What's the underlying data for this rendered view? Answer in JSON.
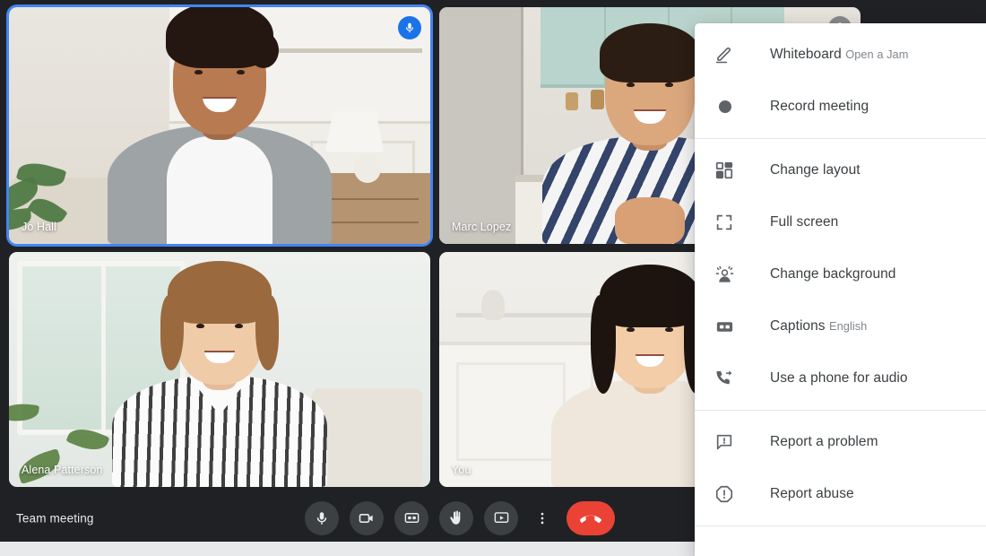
{
  "app": {
    "name": "video-meeting",
    "accent_blue": "#1a73e8",
    "active_border": "#4285f4",
    "hangup_red": "#ea4335",
    "bar_background": "#202124"
  },
  "grid": {
    "tiles": [
      {
        "name": "Jo Hall",
        "mic": "mic-on",
        "active": true,
        "position": "top-left"
      },
      {
        "name": "Marc Lopez",
        "mic": "mic-off",
        "active": false,
        "position": "top-right"
      },
      {
        "name": "Alena Patterson",
        "mic": "none",
        "active": false,
        "position": "bottom-left"
      },
      {
        "name": "You",
        "mic": "none",
        "active": false,
        "position": "bottom-right"
      }
    ]
  },
  "bottom_bar": {
    "meeting_title": "Team meeting",
    "controls": [
      {
        "icon": "microphone-icon",
        "label": "Turn off microphone"
      },
      {
        "icon": "camera-icon",
        "label": "Turn off camera"
      },
      {
        "icon": "captions-cc-icon",
        "label": "Turn on captions"
      },
      {
        "icon": "raise-hand-icon",
        "label": "Raise hand"
      },
      {
        "icon": "present-screen-icon",
        "label": "Present now"
      },
      {
        "icon": "more-options-icon",
        "label": "More options"
      },
      {
        "icon": "end-call-icon",
        "label": "Leave call"
      }
    ]
  },
  "options_menu": {
    "groups": [
      {
        "items": [
          {
            "icon": "whiteboard-pen-icon",
            "label": "Whiteboard",
            "sub": "Open a Jam"
          },
          {
            "icon": "record-dot-icon",
            "label": "Record meeting",
            "sub": ""
          }
        ]
      },
      {
        "items": [
          {
            "icon": "layout-grid-icon",
            "label": "Change layout",
            "sub": ""
          },
          {
            "icon": "fullscreen-icon",
            "label": "Full screen",
            "sub": ""
          },
          {
            "icon": "change-background-icon",
            "label": "Change background",
            "sub": ""
          },
          {
            "icon": "captions-cc-icon",
            "label": "Captions",
            "sub": "English"
          },
          {
            "icon": "phone-audio-icon",
            "label": "Use a phone for audio",
            "sub": ""
          }
        ]
      },
      {
        "items": [
          {
            "icon": "report-problem-icon",
            "label": "Report a problem",
            "sub": ""
          },
          {
            "icon": "report-abuse-icon",
            "label": "Report abuse",
            "sub": ""
          }
        ]
      }
    ]
  }
}
